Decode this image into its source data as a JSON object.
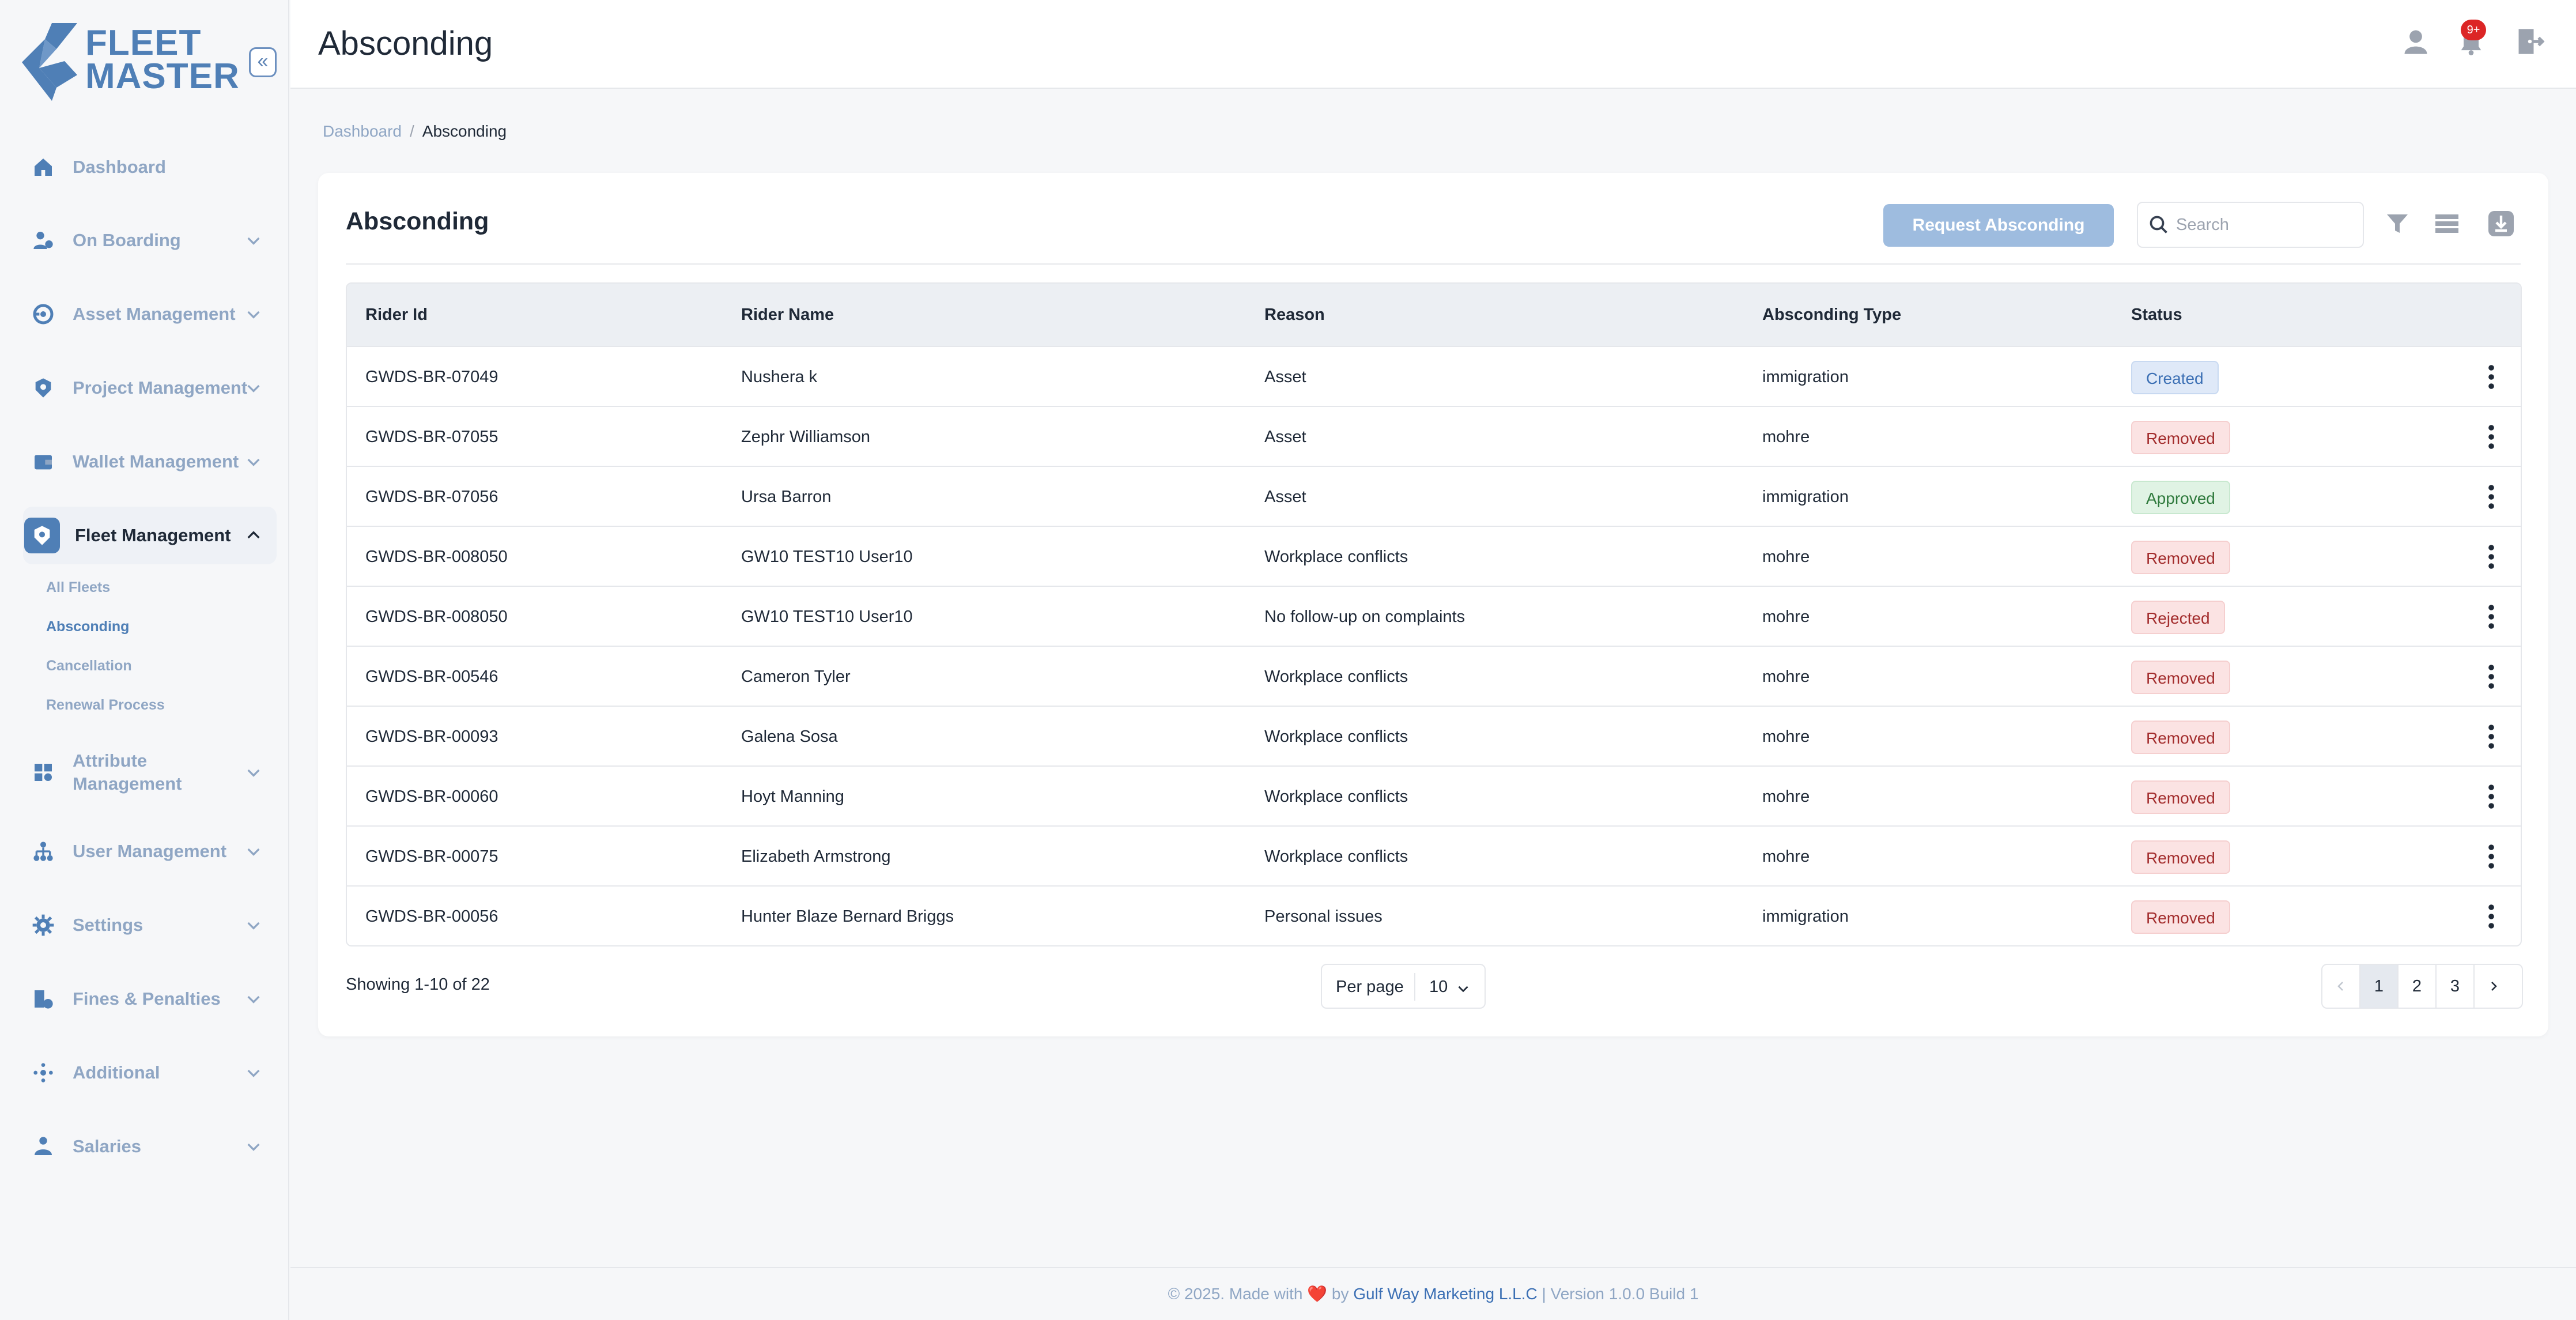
{
  "app": {
    "logo_line1": "FLEET",
    "logo_line2": "MASTER",
    "collapse_glyph": "«"
  },
  "sidebar": {
    "items": [
      {
        "label": "Dashboard",
        "icon": "home-icon"
      },
      {
        "label": "On Boarding",
        "icon": "user-onboard-icon"
      },
      {
        "label": "Asset Management",
        "icon": "asset-icon"
      },
      {
        "label": "Project Management",
        "icon": "project-icon"
      },
      {
        "label": "Wallet Management",
        "icon": "wallet-icon"
      },
      {
        "label": "Fleet Management",
        "icon": "fleet-icon",
        "active": true
      },
      {
        "label": "Attribute\nManagement",
        "icon": "attribute-icon"
      },
      {
        "label": "User Management",
        "icon": "user-tree-icon"
      },
      {
        "label": "Settings",
        "icon": "gear-icon"
      },
      {
        "label": "Fines & Penalties",
        "icon": "fines-icon"
      },
      {
        "label": "Additional",
        "icon": "additional-icon"
      },
      {
        "label": "Salaries",
        "icon": "salaries-icon"
      }
    ],
    "fleet_sub": [
      "All Fleets",
      "Absconding",
      "Cancellation",
      "Renewal Process"
    ],
    "active_sub": "Absconding"
  },
  "header": {
    "title": "Absconding",
    "notification_count": "9+"
  },
  "breadcrumb": {
    "root": "Dashboard",
    "separator": "/",
    "current": "Absconding"
  },
  "card": {
    "title": "Absconding",
    "request_button": "Request Absconding",
    "search_placeholder": "Search"
  },
  "table": {
    "columns": [
      "Rider Id",
      "Rider Name",
      "Reason",
      "Absconding Type",
      "Status"
    ],
    "rows": [
      {
        "id": "GWDS-BR-07049",
        "name": "Nushera k",
        "reason": "Asset",
        "type": "immigration",
        "status": "Created"
      },
      {
        "id": "GWDS-BR-07055",
        "name": "Zephr Williamson",
        "reason": "Asset",
        "type": "mohre",
        "status": "Removed"
      },
      {
        "id": "GWDS-BR-07056",
        "name": "Ursa Barron",
        "reason": "Asset",
        "type": "immigration",
        "status": "Approved"
      },
      {
        "id": "GWDS-BR-008050",
        "name": "GW10 TEST10 User10",
        "reason": "Workplace conflicts",
        "type": "mohre",
        "status": "Removed"
      },
      {
        "id": "GWDS-BR-008050",
        "name": "GW10 TEST10 User10",
        "reason": "No follow-up on complaints",
        "type": "mohre",
        "status": "Rejected"
      },
      {
        "id": "GWDS-BR-00546",
        "name": "Cameron Tyler",
        "reason": "Workplace conflicts",
        "type": "mohre",
        "status": "Removed"
      },
      {
        "id": "GWDS-BR-00093",
        "name": "Galena Sosa",
        "reason": "Workplace conflicts",
        "type": "mohre",
        "status": "Removed"
      },
      {
        "id": "GWDS-BR-00060",
        "name": "Hoyt Manning",
        "reason": "Workplace conflicts",
        "type": "mohre",
        "status": "Removed"
      },
      {
        "id": "GWDS-BR-00075",
        "name": "Elizabeth Armstrong",
        "reason": "Workplace conflicts",
        "type": "mohre",
        "status": "Removed"
      },
      {
        "id": "GWDS-BR-00056",
        "name": "Hunter Blaze Bernard Briggs",
        "reason": "Personal issues",
        "type": "immigration",
        "status": "Removed"
      }
    ]
  },
  "pagination": {
    "showing": "Showing 1-10 of 22",
    "per_page_label": "Per page",
    "per_page_value": "10",
    "pages": [
      "1",
      "2",
      "3"
    ],
    "current_page": "1"
  },
  "footer": {
    "prefix": "© 2025. Made with",
    "heart": "❤️",
    "by": "by",
    "company": "Gulf Way Marketing L.L.C",
    "version": "| Version 1.0.0 Build 1"
  },
  "colors": {
    "brand": "#4f7fb6",
    "muted": "#8fa6c4",
    "danger": "#dc2626"
  }
}
